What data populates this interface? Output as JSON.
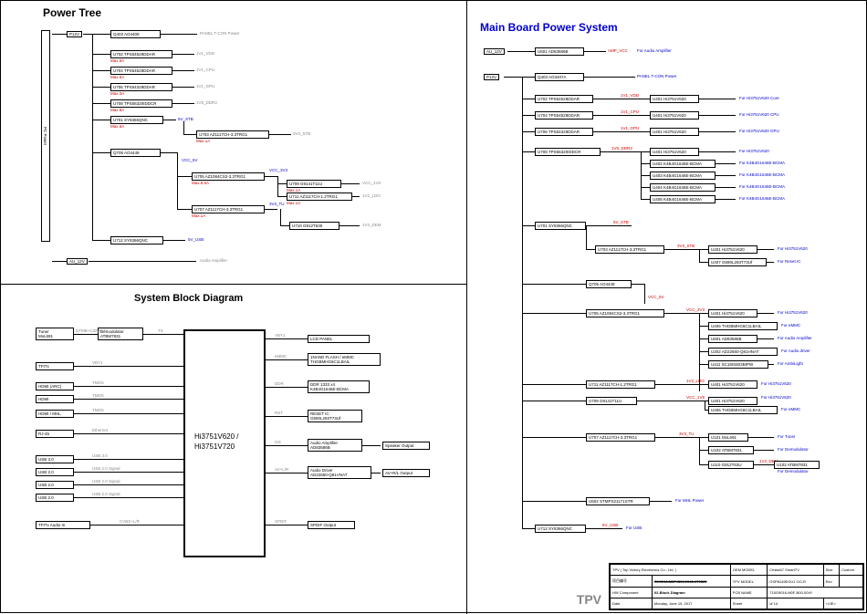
{
  "titles": {
    "power_tree": "Power Tree",
    "main_board": "Main Board Power System",
    "sbd": "System Block Diagram"
  },
  "power_tree": {
    "inputs": {
      "p12v": "P12V",
      "au_12v": "AU_12V",
      "pc_power": "PC Power"
    },
    "nodes": {
      "q403": "Q403 AO4409",
      "u702": "U702 TPS54528DDAR",
      "u704": "U704 TPS54528DDAR",
      "u706": "U706 TPS54328DDAR",
      "u708": "U708 TPS56320IDDCR",
      "u701": "U701 SY8366QNC",
      "u703": "U703 AZ1117CH-3.3TRG1",
      "q705": "Q705 AO4449",
      "u705": "U705 AZ1084CS2-3.3TRG1",
      "u709": "U709 G9141T11U",
      "u711": "U711 AZ1117CH-1.2TRG1",
      "u707": "U707 AZ1117CH-3.3TRG1",
      "u710": "U710 G912T630",
      "u712": "U712 SY8366QNC"
    },
    "rails": {
      "panel": "PANEL T-CON Power",
      "v1_vdd": "1V1_VDD",
      "v1_cpu": "1V1_CPU",
      "v1_gpu": "1V1_GPU",
      "v5_ddr": "1V5_DDR3",
      "5v_stb": "5V_STB",
      "3v3_stb": "3V3_STB",
      "vcc_5v": "VCC_5V",
      "vcc_3v3": "VCC_3V3",
      "vcc_1v8": "VCC_1V8",
      "v2_ldo": "1V2_LDO",
      "3v3_tu": "3V3_TU",
      "v2_dem": "1V2_DEM",
      "5v_usb": "5V_USB",
      "audio_amp": "Audio Amplifier"
    },
    "max": {
      "m5a": "Max.5A",
      "m5a_2": "Max.5A",
      "m3a": "Max.3A",
      "m8a": "Max.8A",
      "m6a": "Max.6A",
      "m1a": "Max.1A",
      "m85a": "Max.8.5A",
      "m1a_2": "Max.1A",
      "m1a_3": "Max.1A"
    }
  },
  "main_board": {
    "inputs": {
      "au_12v": "AU_12V",
      "p12v": "P12V"
    },
    "col1": {
      "u601": "U601 AD83586B",
      "q403": "Q403 AO3407A",
      "u702": "U702 TPS54528DDAR",
      "u704": "U704 TPS54528DDAR",
      "u706": "U706 TPS54328DDAR",
      "u708": "U708 TPS56320IDDCR",
      "u701": "U701 SY8366QNC",
      "u703": "U703 AZ1117CH-3.3TRG1",
      "q705": "Q705 AO4449",
      "u705": "U705 AZ1084CS2-3.3TRG1",
      "u711": "U711 AZ1117CH-1.2TRG1",
      "u709": "U709 G9141T11U",
      "u707": "U707 AZ1117CH-3.3TRG1",
      "u502": "U502 STMPS21171STR",
      "u712": "U712 SY8366QNC"
    },
    "col2": {
      "u401_a": "U401 Hi3751V620",
      "u401_b": "U401 Hi3751V620",
      "u401_c": "U401 Hi3751V620",
      "u401_d": "U401 Hi3751V620",
      "u402": "U402 K4B4G1646E-BCMA",
      "u403": "U403 K4B4G1646E-BCMA",
      "u404": "U404 K4B4G1646E-BCMA",
      "u405": "U405 K4B4G1646E-BCMA",
      "u401_e": "U401 Hi3751V620",
      "u407": "U407 G690L293T73Uf",
      "u401_f": "U401 Hi3751V620",
      "u406": "U406 THGBMHG6C1LBAIL",
      "u601_2": "U601 AD83586B",
      "u302": "U302 AD22650-Q81HNAT",
      "u411": "U411 SC18IS602BIPW",
      "u401_g": "U401 Hi3751V620",
      "u401_h": "U401 Hi3751V620",
      "u406_2": "U406 THGBMHG6C1LBAIL",
      "u101": "U101 MxL691",
      "u102": "U102 ATBM7831",
      "u110": "U110 G912T63U",
      "u102_2": "U102 ATBM7831"
    },
    "purposes": {
      "amp_vcc": "AMP_VCC",
      "audio_amp": "For Audio Amplifier",
      "panel": "PANEL T-CON Power",
      "core": "For Hi3751V620 Core",
      "cpu": "For Hi3751V620 CPU",
      "gpu": "For Hi3751V620 GPU",
      "ddr": "For K4B4G1646E-BCMA",
      "v620": "For Hi3751V620",
      "reset": "For Reset IC",
      "emmc": "For eMMC",
      "aud_drv": "For Audio driver",
      "ambi": "For AmbiLight",
      "tuner": "For Tuner",
      "demod": "For Demodulator",
      "mhl": "For MHL Power",
      "usb": "For USB"
    },
    "rails": {
      "v1_vdd": "1V1_VDD",
      "v1_cpu": "1V1_CPU",
      "v1_gpu": "1V1_GPU",
      "v5_ddr": "1V5_DDR3",
      "5v_stb": "5V_STB",
      "3v3_stb": "3V3_STB",
      "vcc_5v": "VCC_5V",
      "vcc_3v3": "VCC_3V3",
      "v2_ldo": "1V2_LDO",
      "vcc_1v8": "VCC_1V8",
      "3v3_tu": "3V3_TU",
      "v2_dem": "1V2_DEM",
      "5v_usb": "5V_USB"
    }
  },
  "sbd": {
    "main_chip": "Hi3751V620 /\nHi3751V720",
    "left": {
      "tuner": "Tuner\nMxL691",
      "demod": "Demodulator\nATBM7831",
      "tftx": "TFtTx",
      "hdmi_arc": "HDMI (ARC)",
      "hdmi": "HDMI",
      "hdmi_mhl": "HDMI / MHL",
      "rj45": "RJ-45",
      "usb30": "USB 3.0",
      "usb20_1": "USB 2.0",
      "usb20_2": "USB 2.0",
      "usb20_3": "USB 2.0",
      "audio_in": "TFtTx Audio In"
    },
    "left_labels": {
      "dtmb": "DTMB+C/DVB-C",
      "ts": "TS",
      "vby1": "VBY1",
      "tmds1": "TMDS",
      "tmds2": "TMDS",
      "tmds3": "TMDS",
      "eth": "Ethernet",
      "usb30_1": "USB 3.0",
      "usb20_s1": "USB 2.0 Signal",
      "usb20_s2": "USB 2.0 Signal",
      "usb20_s3": "USB 2.0 Signal",
      "cvbs": "CVBS+L/R"
    },
    "right": {
      "lcd": "LCD PANEL",
      "nand": "1NAND FLASH / eMMC\nTHGBMHG6C1LBAIL",
      "ddr": "DDR 1333 x4\nK4B4G1646E-BCMA",
      "reset": "RESET IC\nG690L293T73Uf",
      "aud_amp": "Audio Amplifier\nAD83586B",
      "aud_drv": "Audio Driver\nAD22650-Q81VNAT",
      "spdif": "SPDIF Output",
      "speaker": "Speaker Output",
      "av_out": "AV+R/L Output"
    },
    "right_labels": {
      "vby1": "VBY1",
      "emmc": "eMMC",
      "ddr": "DDR",
      "rst": "RST",
      "i2s": "I2S",
      "av": "AV+L/R",
      "spdif": "SPDIF"
    }
  },
  "titleblock": {
    "co": "TPV | Top Victory Electronics Co., Ltd. |",
    "project": "GX0016-M8F-B02-0040-170525",
    "tpv_model": "TPV MODEL",
    "tpv_model_v": "GSP8149EOU1 OO-R",
    "name": "02-Block Diagram",
    "date": "Date",
    "date_v": "Monday, June 19, 2017",
    "oem_model": "OEM MODEL",
    "oem_v": "Cristal47 SmartTV",
    "pcb": "PCB NAME",
    "pcb_v": "715G9016-M0F-B00-004Y",
    "sheet": "Sheet",
    "sheet_v": "of   14",
    "size": "Size",
    "size_v": "Custom",
    "rev": "Rev",
    "hw": "HW Component",
    "project_label": "项目编号",
    "vie": "<VIE>"
  },
  "logo": "TPV"
}
